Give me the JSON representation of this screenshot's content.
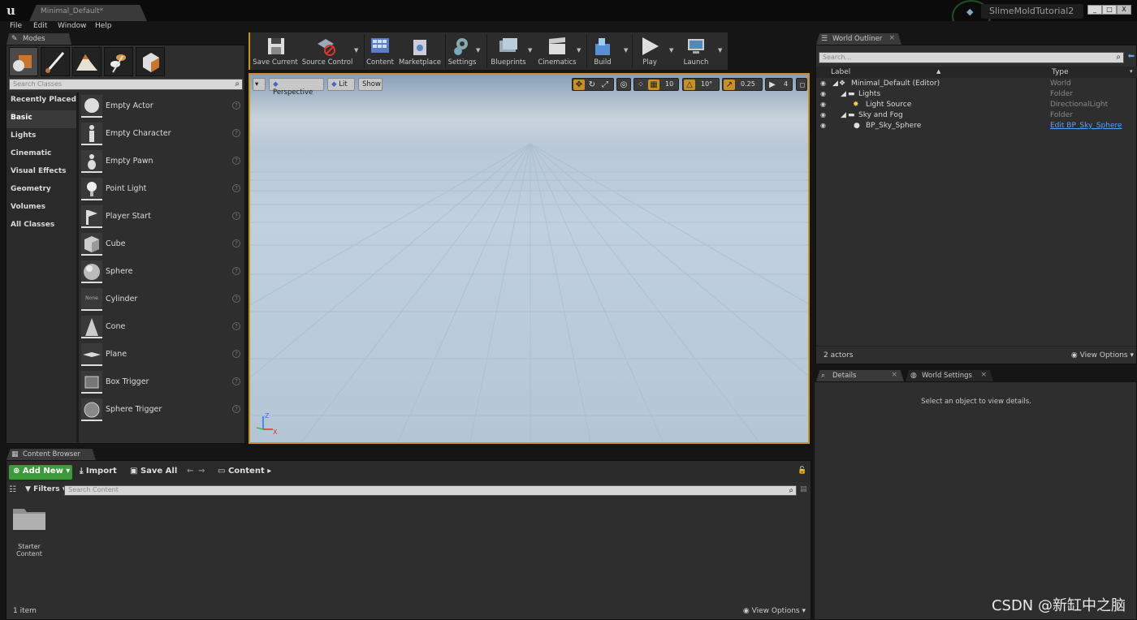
{
  "window": {
    "tab_title": "Minimal_Default*",
    "project": "SlimeMoldTutorial2",
    "min": "_",
    "max": "□",
    "close": "X"
  },
  "menu": [
    "File",
    "Edit",
    "Window",
    "Help"
  ],
  "modes": {
    "tab": "Modes",
    "search_placeholder": "Search Classes",
    "categories": [
      "Recently Placed",
      "Basic",
      "Lights",
      "Cinematic",
      "Visual Effects",
      "Geometry",
      "Volumes",
      "All Classes"
    ],
    "items": [
      "Empty Actor",
      "Empty Character",
      "Empty Pawn",
      "Point Light",
      "Player Start",
      "Cube",
      "Sphere",
      "Cylinder",
      "Cone",
      "Plane",
      "Box Trigger",
      "Sphere Trigger"
    ],
    "cylinder_thumb": "None"
  },
  "toolbar": [
    "Save Current",
    "Source Control",
    "Content",
    "Marketplace",
    "Settings",
    "Blueprints",
    "Cinematics",
    "Build",
    "Play",
    "Launch"
  ],
  "viewport": {
    "perspective": "Perspective",
    "lit": "Lit",
    "show": "Show",
    "grid_snap": "10",
    "rot_snap": "10°",
    "scale_snap": "0.25",
    "cam_speed": "4",
    "axis_z": "Z",
    "axis_x": "X"
  },
  "outliner": {
    "tab": "World Outliner",
    "search_placeholder": "Search...",
    "col_label": "Label",
    "col_type": "Type",
    "rows": [
      {
        "label": "Minimal_Default (Editor)",
        "type": "World"
      },
      {
        "label": "Lights",
        "type": "Folder"
      },
      {
        "label": "Light Source",
        "type": "DirectionalLight"
      },
      {
        "label": "Sky and Fog",
        "type": "Folder"
      },
      {
        "label": "BP_Sky_Sphere",
        "type": "Edit BP_Sky_Sphere"
      }
    ],
    "actors": "2 actors",
    "view_options": "View Options"
  },
  "details": {
    "tab1": "Details",
    "tab2": "World Settings",
    "message": "Select an object to view details."
  },
  "content_browser": {
    "tab": "Content Browser",
    "add_new": "Add New",
    "import": "Import",
    "save_all": "Save All",
    "path": "Content",
    "filters": "Filters",
    "search_placeholder": "Search Content",
    "folder_line1": "Starter",
    "folder_line2": "Content",
    "count": "1 item",
    "view_options": "View Options"
  },
  "watermark": "CSDN @新缸中之脑"
}
